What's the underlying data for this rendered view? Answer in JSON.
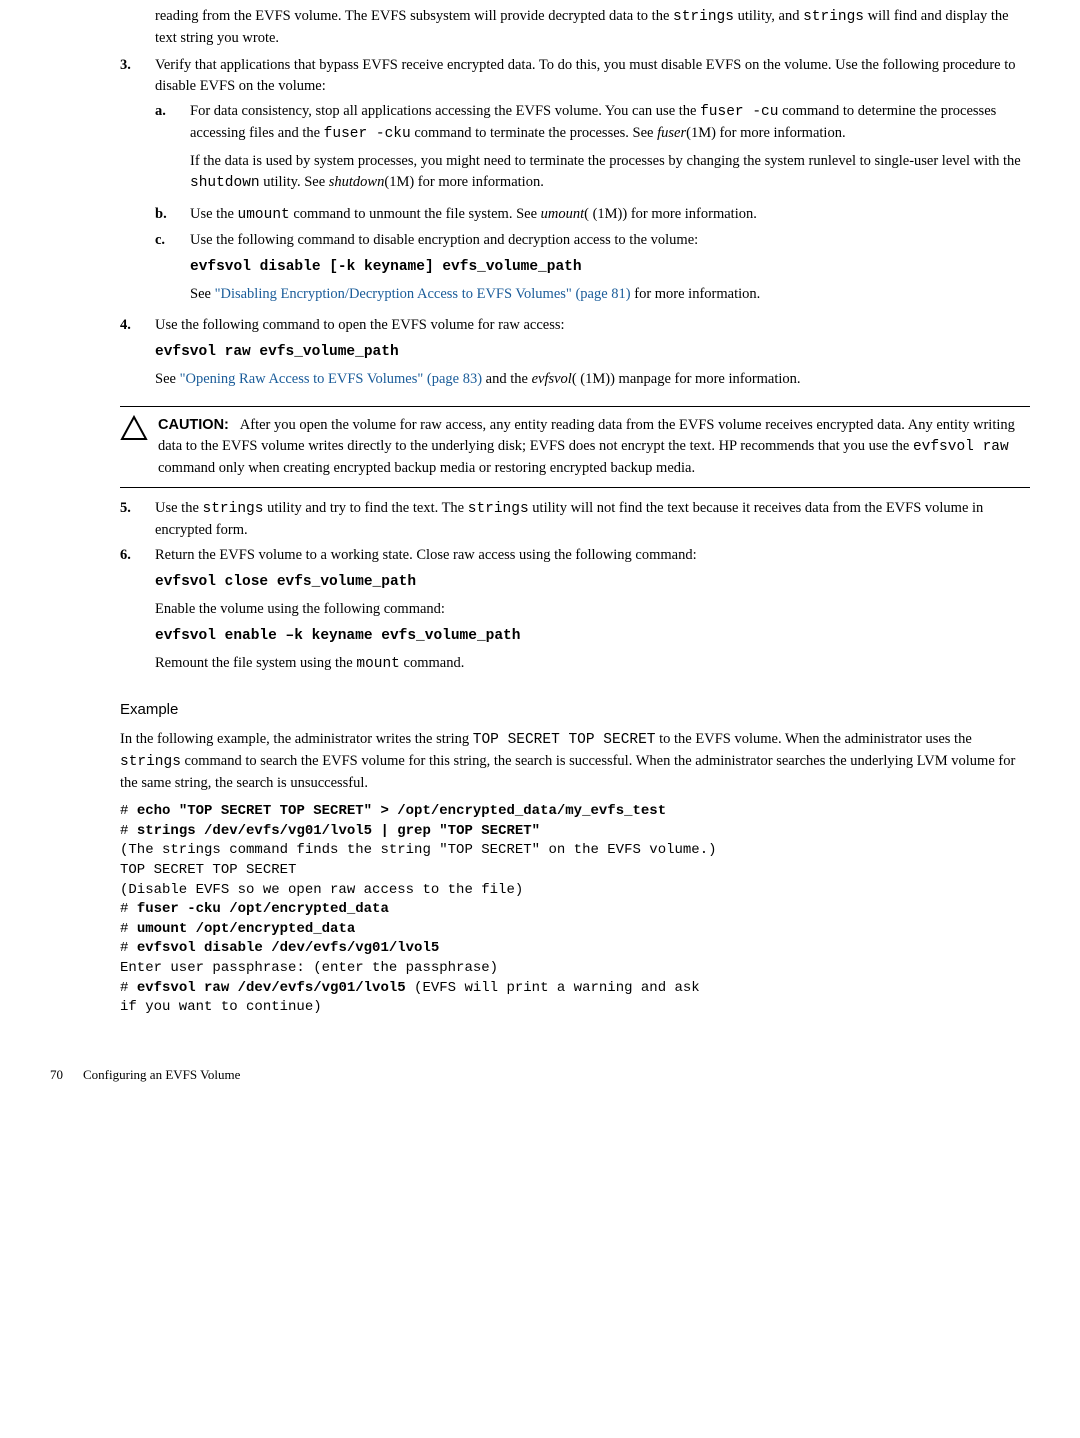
{
  "p_intro1": "reading from the EVFS volume. The EVFS subsystem will provide decrypted data to the ",
  "p_intro2": " utility, and ",
  "p_intro3": " will find and display the text string you wrote.",
  "strings": "strings",
  "item3_num": "3.",
  "item3_text": "Verify that applications that bypass EVFS receive encrypted data. To do this, you must disable EVFS on the volume. Use the following procedure to disable EVFS on the volume:",
  "a_num": "a.",
  "a_t1": "For data consistency, stop all applications accessing the EVFS volume. You can use the ",
  "a_code1": "fuser -cu",
  "a_t2": " command to determine the processes accessing files and the ",
  "a_code2": "fuser -cku",
  "a_t3": " command to terminate the processes. See ",
  "a_it1": "fuser",
  "a_t4": "(1M) for more information.",
  "a_p2_t1": "If the data is used by system processes, you might need to terminate the processes by changing the system runlevel to single-user level with the ",
  "a_p2_code": "shutdown",
  "a_p2_t2": " utility. See ",
  "a_p2_it": "shutdown",
  "a_p2_t3": "(1M) for more information.",
  "b_num": "b.",
  "b_t1": "Use the ",
  "b_code": "umount",
  "b_t2": " command to unmount the file system. See ",
  "b_it": "umount",
  "b_t3": "( (1M)) for more information.",
  "c_num": "c.",
  "c_text": "Use the following command to disable encryption and decryption access to the volume:",
  "c_cmd": "evfsvol disable [-k keyname] evfs_volume_path",
  "c_see1": "See ",
  "c_link": "\"Disabling Encryption/Decryption Access to EVFS Volumes\" (page 81)",
  "c_see2": " for more information.",
  "item4_num": "4.",
  "item4_text": "Use the following command to open the EVFS volume for raw access:",
  "item4_cmd": "evfsvol raw evfs_volume_path",
  "item4_see1": "See ",
  "item4_link": "\"Opening Raw Access to EVFS Volumes\" (page 83)",
  "item4_see2": " and the ",
  "item4_it": "evfsvol",
  "item4_see3": "( (1M)) manpage for more information.",
  "caution_label": "CAUTION:",
  "caution_t1": "After you open the volume for raw access, any entity reading data from the EVFS volume receives encrypted data. Any entity writing data to the EVFS volume writes directly to the underlying disk; EVFS does not encrypt the text. HP recommends that you use the ",
  "caution_code": "evfsvol raw",
  "caution_t2": " command only when creating encrypted backup media or restoring encrypted backup media.",
  "item5_num": "5.",
  "item5_t1": "Use the ",
  "item5_t2": " utility and try to find the text. The ",
  "item5_t3": " utility will not find the text because it receives data from the EVFS volume in encrypted form.",
  "item6_num": "6.",
  "item6_text": "Return the EVFS volume to a working state. Close raw access using the following command:",
  "item6_cmd1": "evfsvol close evfs_volume_path",
  "item6_p2": "Enable the volume using the following command:",
  "item6_cmd2": "evfsvol enable –k keyname evfs_volume_path",
  "item6_p3_t1": "Remount the file system using the ",
  "item6_p3_code": "mount",
  "item6_p3_t2": " command.",
  "example_heading": "Example",
  "example_p_t1": "In the following example, the administrator writes the string ",
  "example_p_code": "TOP SECRET TOP SECRET",
  "example_p_t2": " to the EVFS volume. When the administrator uses the ",
  "example_p_t3": " command to search the EVFS volume for this string, the search is successful. When the administrator searches the underlying LVM volume for the same string, the search is unsuccessful.",
  "cb_l1_h": "# ",
  "cb_l1_b": "echo \"TOP SECRET TOP SECRET\" > /opt/encrypted_data/my_evfs_test",
  "cb_l2_h": "# ",
  "cb_l2_b": "strings /dev/evfs/vg01/lvol5 | grep \"TOP SECRET\"",
  "cb_l3": "(The strings command finds the string \"TOP SECRET\" on the EVFS volume.)",
  "cb_l4": "TOP SECRET TOP SECRET",
  "cb_l5": "(Disable EVFS so we open raw access to the file)",
  "cb_l6_h": "# ",
  "cb_l6_b": "fuser -cku /opt/encrypted_data",
  "cb_l7_h": "# ",
  "cb_l7_b": "umount /opt/encrypted_data",
  "cb_l8_h": "# ",
  "cb_l8_b": "evfsvol disable /dev/evfs/vg01/lvol5",
  "cb_l9": "Enter user passphrase: (enter the passphrase)",
  "cb_l10_h": "# ",
  "cb_l10_b": "evfsvol raw /dev/evfs/vg01/lvol5",
  "cb_l10_t": " (EVFS will print a warning and ask",
  "cb_l11": "if you want to continue)",
  "footer_num": "70",
  "footer_text": "Configuring an EVFS Volume"
}
